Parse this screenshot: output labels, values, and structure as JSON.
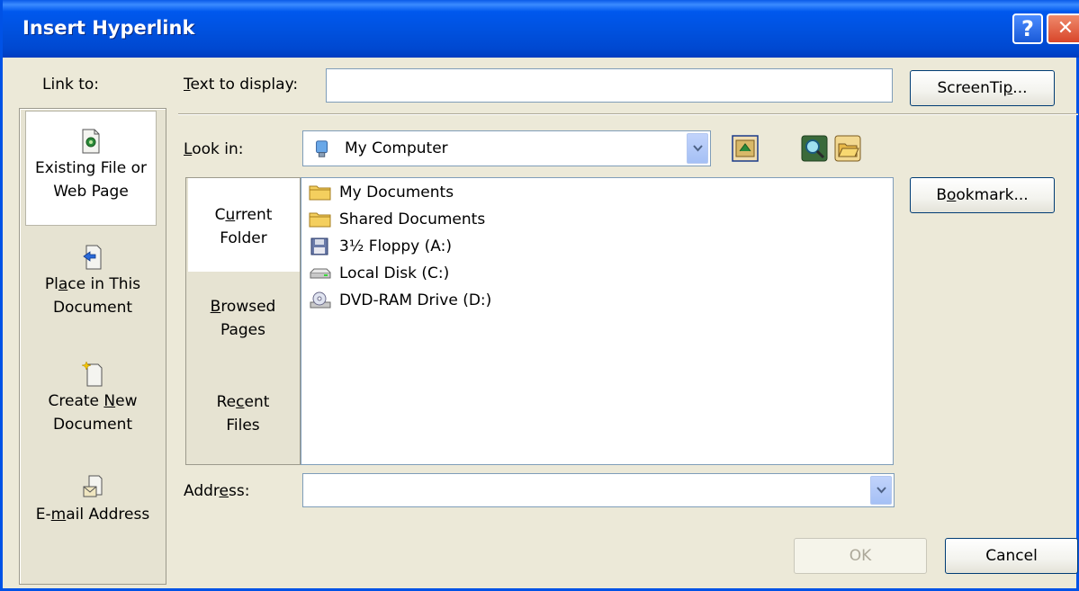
{
  "window": {
    "title": "Insert Hyperlink",
    "help_glyph": "?",
    "close_glyph": "✕"
  },
  "link_to": {
    "label": "Link to:",
    "items": [
      {
        "line1": "Existing File or",
        "line2": "Web Page",
        "icon": "existing-file-icon",
        "selected": true
      },
      {
        "line1": "Place in This",
        "line2": "Document",
        "icon": "place-in-document-icon",
        "selected": false
      },
      {
        "line1": "Create New",
        "line2": "Document",
        "icon": "new-document-icon",
        "selected": false
      },
      {
        "line1": "E-mail Address",
        "line2": "",
        "icon": "email-address-icon",
        "selected": false
      }
    ]
  },
  "text_to_display": {
    "label": "Text to display:",
    "value": ""
  },
  "screentip_button": "ScreenTip...",
  "look_in": {
    "label": "Look in:",
    "value": "My Computer"
  },
  "places": [
    {
      "line1": "Current",
      "line2": "Folder",
      "selected": true
    },
    {
      "line1": "Browsed",
      "line2": "Pages",
      "selected": false
    },
    {
      "line1": "Recent",
      "line2": "Files",
      "selected": false
    }
  ],
  "files": [
    {
      "name": "My Documents",
      "icon": "folder-icon"
    },
    {
      "name": "Shared Documents",
      "icon": "folder-icon"
    },
    {
      "name": "3½ Floppy (A:)",
      "icon": "floppy-drive-icon"
    },
    {
      "name": "Local Disk (C:)",
      "icon": "local-disk-icon"
    },
    {
      "name": "DVD-RAM Drive (D:)",
      "icon": "dvd-drive-icon"
    }
  ],
  "bookmark_button": "Bookmark...",
  "address": {
    "label": "Address:",
    "value": ""
  },
  "ok_button": "OK",
  "cancel_button": "Cancel"
}
